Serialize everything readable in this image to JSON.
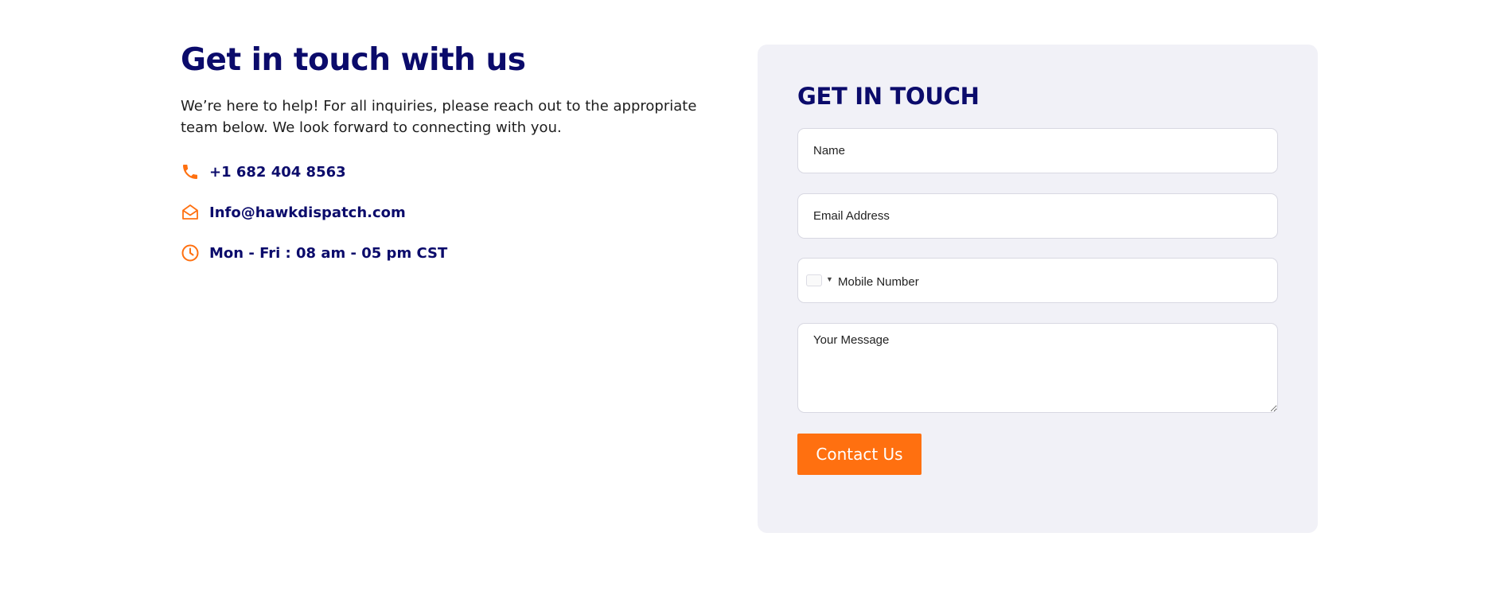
{
  "left": {
    "heading": "Get in touch with us",
    "intro": "We’re here to help! For all inquiries, please reach out to the appropriate team below. We look forward to connecting with you.",
    "contacts": [
      {
        "icon": "phone-icon",
        "text": "+1 682 404 8563"
      },
      {
        "icon": "envelope-icon",
        "text": "Info@hawkdispatch.com"
      },
      {
        "icon": "clock-icon",
        "text": "Mon - Fri : 08 am - 05 pm CST"
      }
    ]
  },
  "form": {
    "title": "GET IN TOUCH",
    "name_placeholder": "Name",
    "email_placeholder": "Email Address",
    "phone_placeholder": "Mobile Number",
    "message_placeholder": "Your Message",
    "submit_label": "Contact Us"
  },
  "colors": {
    "navy": "#0b0b6b",
    "accent": "#ff7010",
    "card_bg": "#f1f1f7"
  }
}
